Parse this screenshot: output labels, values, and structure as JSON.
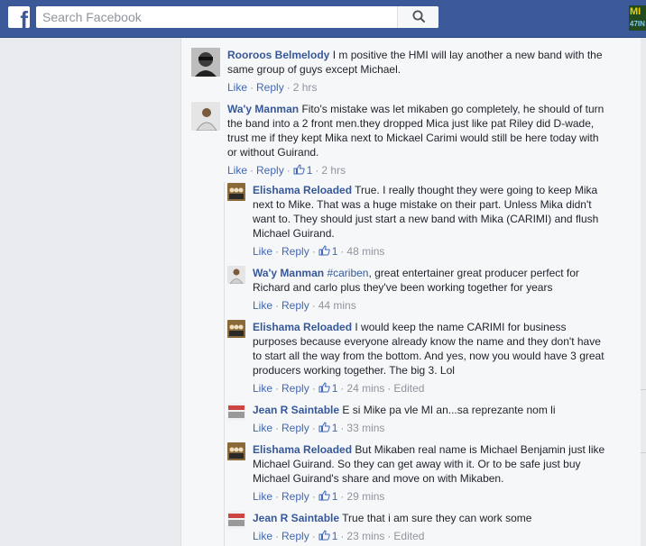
{
  "header": {
    "logo": "f",
    "search_placeholder": "Search Facebook",
    "badge_top": "MI",
    "badge_bottom": "47IN"
  },
  "icons": {
    "logo": "facebook-logo-icon",
    "search": "search-icon",
    "like": "thumbs-up-icon"
  },
  "colors": {
    "topbar": "#3b5998",
    "link": "#4267b2",
    "author": "#365899",
    "meta": "#90949c"
  },
  "top_comments": [
    {
      "author": "Rooroos Belmelody",
      "text": "I m positive the HMI will lay another a new band with the same group of guys except Michael.",
      "like": "Like",
      "reply": "Reply",
      "likes": "",
      "time": "2 hrs"
    },
    {
      "author": "Wa'y Manman",
      "text": "Fito's mistake was let mikaben go completely, he should of turn the band into a 2 front men.they dropped Mica just like pat Riley did D-wade, trust me if they kept Mika next to Mickael Carimi would still be here today with or without Guirand.",
      "like": "Like",
      "reply": "Reply",
      "likes": "1",
      "time": "2 hrs"
    }
  ],
  "replies": [
    {
      "author": "Elishama Reloaded",
      "text": "True. I really thought they were going to keep Mika next to Mike. That was a huge mistake on their part. Unless Mika didn't want to. They should just start a new band with Mika (CARIMI) and flush Michael Guirand.",
      "like": "Like",
      "reply": "Reply",
      "likes": "1",
      "time": "48 mins"
    },
    {
      "author": "Wa'y Manman",
      "hashtag": "#cariben",
      "text": ", great entertainer great producer perfect for Richard and carlo plus they've been working together for years",
      "like": "Like",
      "reply": "Reply",
      "time": "44 mins"
    },
    {
      "author": "Elishama Reloaded",
      "text": "I would keep the name CARIMI for business purposes because everyone already know the name and they don't have to start all the way from the bottom. And yes, now you would have 3 great producers working together. The big 3. Lol",
      "like": "Like",
      "reply": "Reply",
      "likes": "1",
      "time": "24 mins",
      "edited": "Edited"
    },
    {
      "author": "Jean R Saintable",
      "text": "E si Mike pa vle MI an...sa reprezante nom li",
      "like": "Like",
      "reply": "Reply",
      "likes": "1",
      "time": "33 mins"
    },
    {
      "author": "Elishama Reloaded",
      "text": "But Mikaben real name is Michael Benjamin just like Michael Guirand. So they can get away with it. Or to be safe just buy Michael Guirand's share and move on with Mikaben.",
      "like": "Like",
      "reply": "Reply",
      "likes": "1",
      "time": "29 mins"
    },
    {
      "author": "Jean R Saintable",
      "text": "True that i am sure they can work some",
      "like": "Like",
      "reply": "Reply",
      "likes": "1",
      "time": "23 mins",
      "edited": "Edited"
    }
  ]
}
